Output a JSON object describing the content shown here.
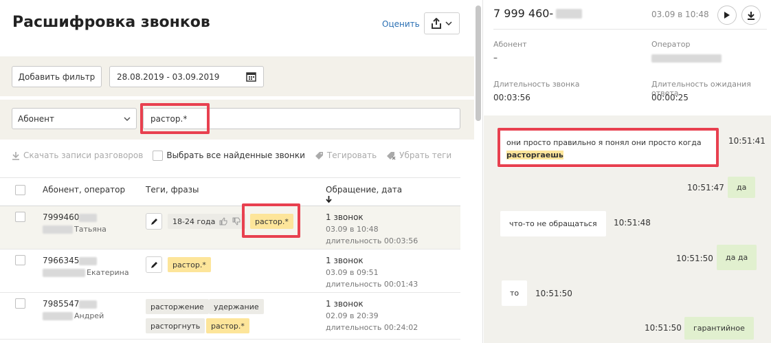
{
  "header": {
    "title": "Расшифровка звонков",
    "rate_link": "Оценить"
  },
  "filters": {
    "add_filter_label": "Добавить фильтр",
    "date_range": "28.08.2019 - 03.09.2019",
    "field_select": "Абонент",
    "query": "растор.*"
  },
  "toolbar": {
    "download": "Скачать записи разговоров",
    "select_all": "Выбрать все найденные звонки",
    "tag": "Тегировать",
    "untag": "Убрать теги"
  },
  "table": {
    "headers": {
      "subscriber": "Абонент, оператор",
      "tags": "Теги, фразы",
      "date": "Обращение, дата"
    },
    "rows": [
      {
        "number": "7999460",
        "operator": "Татьяна",
        "tags": [
          "18-24 года",
          "растор.*"
        ],
        "calls": "1 звонок",
        "date": "03.09 в 10:48",
        "duration": "длительность 00:03:56"
      },
      {
        "number": "7966345",
        "operator": "Екатерина",
        "tags": [
          "растор.*"
        ],
        "calls": "1 звонок",
        "date": "03.09 в 09:51",
        "duration": "длительность 00:01:43"
      },
      {
        "number": "7985547",
        "operator": "Андрей",
        "tags": [
          "расторжение",
          "удержание",
          "расторгнуть",
          "растор.*"
        ],
        "calls": "1 звонок",
        "date": "02.09 в 20:39",
        "duration": "длительность 00:24:02"
      }
    ]
  },
  "details": {
    "phone": "7 999 460-",
    "time": "03.09 в 10:48",
    "subscriber_label": "Абонент",
    "subscriber_value": "–",
    "operator_label": "Оператор",
    "call_duration_label": "Длительность звонка",
    "call_duration_value": "00:03:56",
    "wait_label": "Длительность ожидания ответа",
    "wait_value": "00:00:25"
  },
  "chat": {
    "messages": [
      {
        "side": "client",
        "text": "они просто правильно я понял они просто когда",
        "highlight": "расторгаешь",
        "time": "10:51:41"
      },
      {
        "side": "operator",
        "text": "да",
        "time": "10:51:47"
      },
      {
        "side": "client",
        "text": "что-то не обращаться",
        "time": "10:51:48"
      },
      {
        "side": "operator",
        "text": "да да",
        "time": "10:51:50"
      },
      {
        "side": "client",
        "text": "то",
        "time": "10:51:50"
      },
      {
        "side": "operator",
        "text": "гарантийное",
        "time": "10:51:50"
      }
    ]
  },
  "colors": {
    "accent_link": "#2a6fb3",
    "highlight_border": "#e8404f",
    "tag_yellow": "#fde59a",
    "operator_bubble": "#e1f0cf",
    "filter_band": "#f3f1ea"
  }
}
